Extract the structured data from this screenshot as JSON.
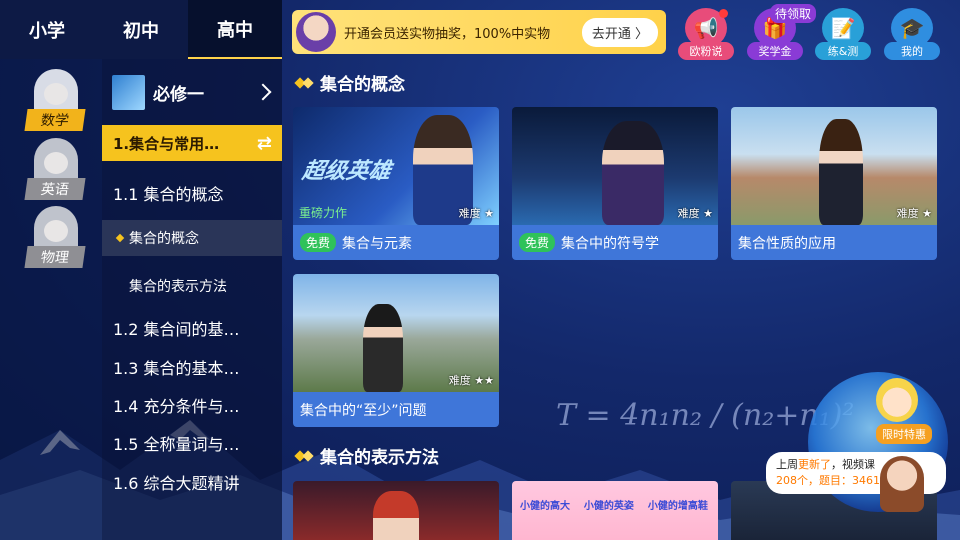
{
  "grade_tabs": [
    {
      "label": "小学"
    },
    {
      "label": "初中"
    },
    {
      "label": "高中"
    }
  ],
  "subjects": [
    {
      "label": "数学"
    },
    {
      "label": "英语"
    },
    {
      "label": "物理"
    }
  ],
  "book": {
    "title": "必修一"
  },
  "toc": {
    "chapter": "1.集合与常用…",
    "items": [
      {
        "label": "1.1 集合的概念"
      },
      {
        "label": "集合的概念"
      },
      {
        "label": "集合的表示方法"
      },
      {
        "label": "1.2 集合间的基…"
      },
      {
        "label": "1.3 集合的基本…"
      },
      {
        "label": "1.4 充分条件与…"
      },
      {
        "label": "1.5 全称量词与…"
      },
      {
        "label": "1.6 综合大题精讲"
      }
    ]
  },
  "promo": {
    "text": "开通会员送实物抽奖，100%中实物",
    "button": "去开通 〉"
  },
  "top_icons": [
    {
      "label": "欧粉说",
      "icon": "megaphone-icon",
      "color": "#e84c7a"
    },
    {
      "label": "奖学金",
      "icon": "gift-icon",
      "color": "#8a3bd6",
      "badge": "待领取"
    },
    {
      "label": "练&测",
      "icon": "test-paper-icon",
      "color": "#29a0d8"
    },
    {
      "label": "我的",
      "icon": "graduation-cap-icon",
      "color": "#2f8ee0"
    }
  ],
  "sections": [
    {
      "title": "集合的概念",
      "cards": [
        {
          "title": "集合与元素",
          "free": "免费",
          "difficulty": "难度 ★",
          "subtitle": "重磅力作",
          "poster_title": "超级英雄"
        },
        {
          "title": "集合中的符号学",
          "free": "免费",
          "difficulty": "难度 ★"
        },
        {
          "title": "集合性质的应用",
          "difficulty": "难度 ★"
        },
        {
          "title": "集合中的“至少”问题",
          "difficulty": "难度 ★★"
        }
      ]
    },
    {
      "title": "集合的表示方法"
    }
  ],
  "next_card_text": "小健的高大    小健的英姿    小健的增高鞋",
  "formula": "T = 4n₁n₂ / (n₂+n₁)²",
  "mascot": {
    "tag": "限时特惠",
    "bubble_prefix": "上周",
    "bubble_highlight": "更新了",
    "bubble_suffix": "，视频课",
    "bubble_line2": "208个，题目：3461"
  }
}
